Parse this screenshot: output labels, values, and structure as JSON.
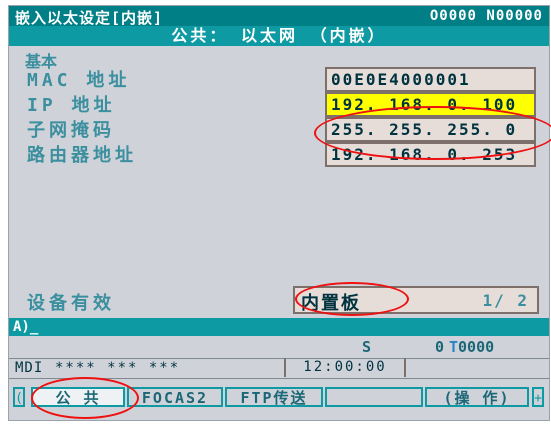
{
  "title_bar": {
    "left_text": "嵌入以太设定[内嵌]",
    "right_text": "O0000 N00000"
  },
  "subtitle": "公共： 以太网  （内嵌）",
  "section": {
    "label": "基本"
  },
  "fields": [
    {
      "label": "MAC 地址",
      "value": "00E0E4000001"
    },
    {
      "label": "IP 地址",
      "value": "192. 168. 0. 100",
      "highlighted": true
    },
    {
      "label": "子网掩码",
      "value": "255. 255. 255. 0"
    },
    {
      "label": "路由器地址",
      "value": "192. 168. 0. 253"
    }
  ],
  "device": {
    "label": "设备有效",
    "value": "内置板",
    "page": "1/ 2"
  },
  "input_bar": {
    "prompt": "A)_"
  },
  "status": {
    "s_label": "S",
    "zero": "0",
    "t_prefix": "T",
    "t_code": "0000"
  },
  "mode_row": {
    "mode": "MDI",
    "stars": "**** *** ***",
    "time": "12:00:00"
  },
  "softkeys": {
    "left_edge": "(",
    "keys": [
      {
        "label": "公 共",
        "selected": true
      },
      {
        "label": "FOCAS2"
      },
      {
        "label": "FTP传送"
      },
      {
        "label": ""
      },
      {
        "label": "(操 作)"
      }
    ],
    "right_edge": "+"
  },
  "colors": {
    "title_bg": "#007f86",
    "subtitle_bg": "#0e9aa3",
    "screen_bg": "#cfd3d9",
    "label_teal": "#3b8f9e",
    "field_bg": "#e6dcd8",
    "highlight_yellow": "#ffff00",
    "annotation_red": "#e11111"
  }
}
